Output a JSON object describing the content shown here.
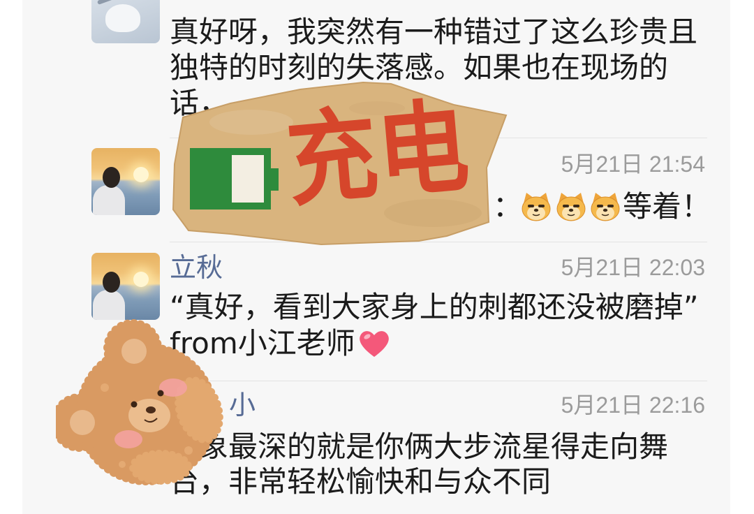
{
  "colors": {
    "page_bg": "#ffffff",
    "panel_bg": "#f7f7f7",
    "text": "#1b1b1b",
    "name": "#576b95",
    "time": "#9b9b9b",
    "divider": "#e3e3e3",
    "sticker_paper": "#d9b47e",
    "sticker_text": "#d6462b",
    "battery": "#2e8b3c",
    "bear_fur": "#d99a62",
    "heart": "#f4587a"
  },
  "comments": [
    {
      "avatar_icon": "anime-drawing-avatar",
      "lines": [
        "真好呀，我突然有一种错过了这么珍贵且",
        "独特的时刻的失落感。如果也在现场的",
        "话，"
      ]
    },
    {
      "avatar_icon": "sunset-avatar",
      "time": "5月21日 21:54",
      "text_start": "：",
      "emoji": [
        "doge-emoji",
        "doge-emoji",
        "doge-emoji"
      ],
      "text_end": "等着！"
    },
    {
      "avatar_icon": "sunset-avatar",
      "name": "立秋",
      "time": "5月21日 22:03",
      "lines": [
        "“真好，看到大家身上的刺都还没被磨掉”",
        "from小江老师"
      ],
      "trailing_emoji": "heart-emoji"
    },
    {
      "name": "小",
      "time": "5月21日 22:16",
      "lines": [
        "印象最深的就是你俩大步流星得走向舞",
        "台，非常轻松愉快和与众不同"
      ]
    }
  ],
  "stickers": {
    "charging": {
      "text": "充电",
      "icon": "battery-icon"
    },
    "bear": {
      "icon": "teddy-bear-icon"
    }
  }
}
